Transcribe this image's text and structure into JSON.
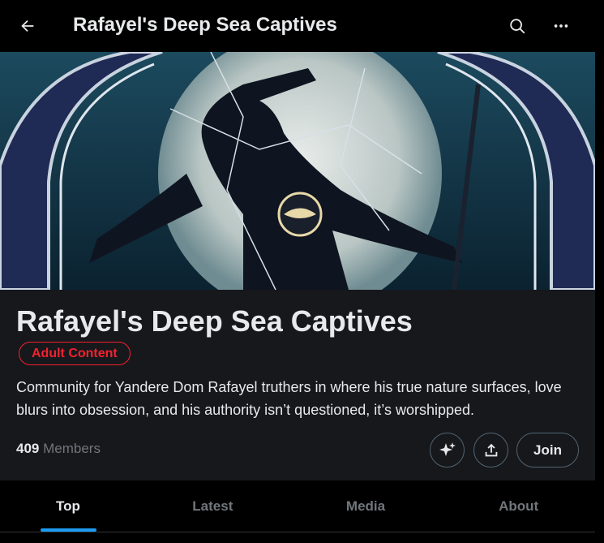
{
  "topbar": {
    "title": "Rafayel's Deep Sea Captives"
  },
  "community": {
    "name": "Rafayel's Deep Sea Captives",
    "badge": "Adult Content",
    "description": "Community for Yandere Dom Rafayel truthers in where his true nature surfaces, love blurs into obsession, and his authority isn’t questioned, it’s worshipped.",
    "member_count": "409",
    "member_label": "Members",
    "join_label": "Join"
  },
  "tabs": [
    {
      "label": "Top",
      "active": true
    },
    {
      "label": "Latest",
      "active": false
    },
    {
      "label": "Media",
      "active": false
    },
    {
      "label": "About",
      "active": false
    }
  ],
  "colors": {
    "background": "#000000",
    "panel": "#16181c",
    "text": "#e7e9ea",
    "muted": "#71767b",
    "accent": "#1d9bf0",
    "danger": "#f4212e"
  },
  "icons": {
    "back": "arrow-left-icon",
    "search": "search-icon",
    "more": "more-horizontal-icon",
    "spark": "sparkle-icon",
    "share": "share-icon"
  }
}
